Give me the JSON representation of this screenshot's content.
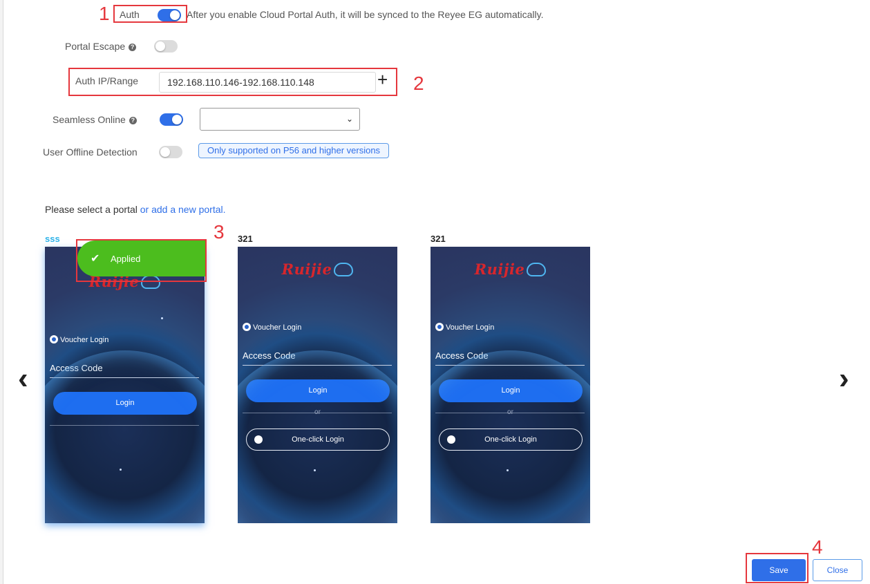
{
  "auth": {
    "label": "Auth",
    "enabled": true,
    "note": "After you enable Cloud Portal Auth, it will be synced to the Reyee EG automatically."
  },
  "portal_escape": {
    "label": "Portal Escape",
    "enabled": false
  },
  "auth_ip": {
    "label": "Auth IP/Range",
    "value": "192.168.110.146-192.168.110.148",
    "add_icon": "+"
  },
  "seamless": {
    "label": "Seamless Online",
    "enabled": true,
    "select_value": ""
  },
  "offline": {
    "label": "User Offline Detection",
    "enabled": false,
    "tag": "Only supported on P56 and higher versions"
  },
  "portal_select": {
    "prompt": "Please select a portal ",
    "link": "or add a new portal."
  },
  "portals": [
    {
      "name": "sss",
      "name_color": "#2fb3e8",
      "applied_label": "Applied",
      "logo": "Ruijie",
      "voucher": "Voucher Login",
      "access": "Access Code",
      "login": "Login"
    },
    {
      "name": "321",
      "logo": "Ruijie",
      "voucher": "Voucher Login",
      "access": "Access Code",
      "login": "Login",
      "or": "or",
      "oneclick": "One-click Login"
    },
    {
      "name": "321",
      "logo": "Ruijie",
      "voucher": "Voucher Login",
      "access": "Access Code",
      "login": "Login",
      "or": "or",
      "oneclick": "One-click Login"
    }
  ],
  "nav": {
    "prev": "‹",
    "next": "›"
  },
  "annotations": [
    "1",
    "2",
    "3",
    "4"
  ],
  "footer": {
    "save": "Save",
    "close": "Close"
  },
  "colors": {
    "accent": "#2f6fe8",
    "applied": "#4cbd1e",
    "annotation": "#e5373d",
    "brand_red": "#d7262c"
  }
}
